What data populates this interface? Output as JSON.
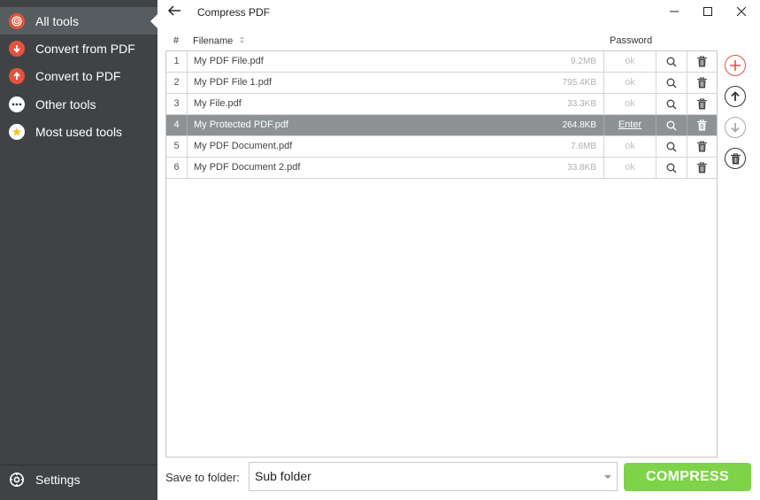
{
  "sidebar": {
    "items": [
      {
        "label": "All tools",
        "icon": "all-tools-icon",
        "active": true
      },
      {
        "label": "Convert from PDF",
        "icon": "convert-from-pdf-icon"
      },
      {
        "label": "Convert to PDF",
        "icon": "convert-to-pdf-icon"
      },
      {
        "label": "Other tools",
        "icon": "other-tools-icon"
      },
      {
        "label": "Most used tools",
        "icon": "star-icon"
      }
    ],
    "settings": {
      "label": "Settings",
      "icon": "gear-icon"
    }
  },
  "titlebar": {
    "title": "Compress PDF"
  },
  "table": {
    "headers": {
      "num": "#",
      "filename": "Filename",
      "password": "Password"
    },
    "rows": [
      {
        "num": "1",
        "name": "My PDF File.pdf",
        "size": "9.2MB",
        "password": "ok"
      },
      {
        "num": "2",
        "name": "My PDF File 1.pdf",
        "size": "795.4KB",
        "password": "ok"
      },
      {
        "num": "3",
        "name": "My File.pdf",
        "size": "33.3KB",
        "password": "ok"
      },
      {
        "num": "4",
        "name": "My Protected PDF.pdf",
        "size": "264.8KB",
        "password": "Enter",
        "selected": true
      },
      {
        "num": "5",
        "name": "My PDF Document.pdf",
        "size": "7.6MB",
        "password": "ok"
      },
      {
        "num": "6",
        "name": "My PDF Document 2.pdf",
        "size": "33.8KB",
        "password": "ok"
      }
    ]
  },
  "footer": {
    "save_label": "Save to folder:",
    "folder_value": "Sub folder",
    "compress_label": "COMPRESS"
  },
  "colors": {
    "sidebar_bg": "#3f4346",
    "selected_row": "#8e9295",
    "compress_green": "#7ed348",
    "add_red": "#e5533d"
  }
}
